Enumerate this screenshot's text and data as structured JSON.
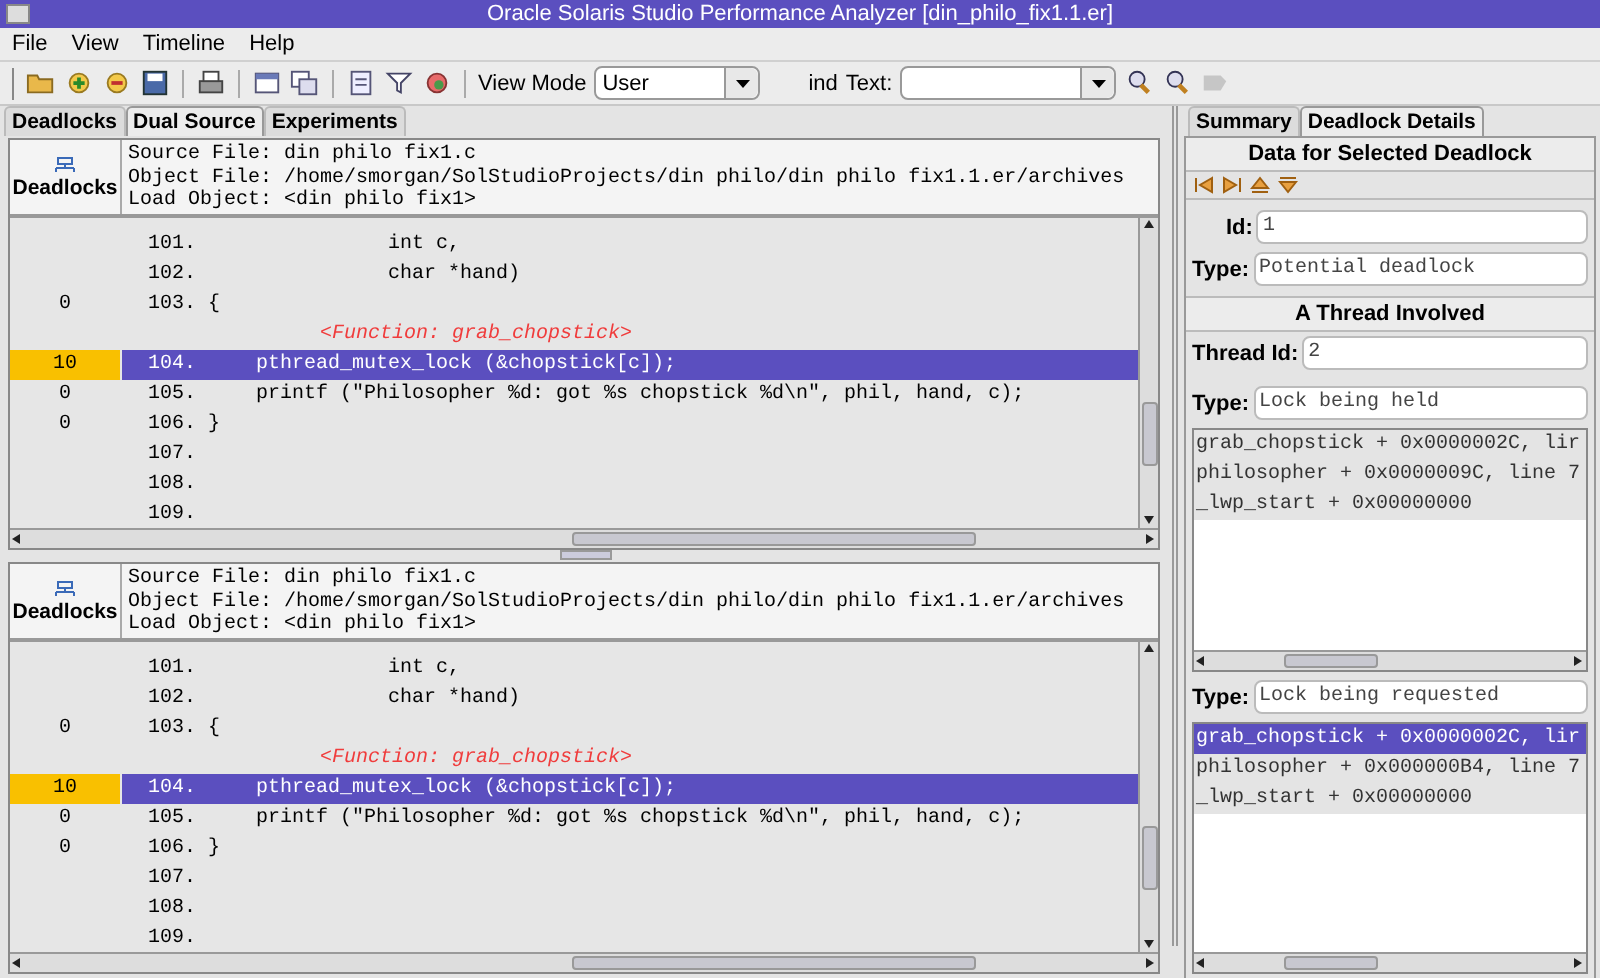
{
  "window": {
    "title": "Oracle Solaris Studio Performance Analyzer [din_philo_fix1.1.er]"
  },
  "menu": [
    "File",
    "View",
    "Timeline",
    "Help"
  ],
  "toolbar": {
    "icons": [
      {
        "kind": "folder"
      },
      {
        "kind": "add"
      },
      {
        "kind": "remove"
      },
      {
        "kind": "save"
      },
      {
        "kind": "sep"
      },
      {
        "kind": "print"
      },
      {
        "kind": "sep"
      },
      {
        "kind": "window"
      },
      {
        "kind": "windows"
      },
      {
        "kind": "sep"
      },
      {
        "kind": "doc"
      },
      {
        "kind": "filter"
      },
      {
        "kind": "target"
      }
    ],
    "view_mode_label": "View Mode",
    "view_mode": "User",
    "find_label": "ind",
    "text_label": "Text:",
    "find_icons": [
      {
        "kind": "find"
      },
      {
        "kind": "find"
      },
      {
        "kind": "clear",
        "disabled": true
      }
    ]
  },
  "tabs": [
    {
      "label": "Deadlocks",
      "selected": false
    },
    {
      "label": "Dual Source",
      "selected": true
    },
    {
      "label": "Experiments",
      "selected": false
    }
  ],
  "panes": [
    {
      "metric_header": "Deadlocks",
      "source_file": "Source File: din philo fix1.c",
      "object_file": "Object File: /home/smorgan/SolStudioProjects/din philo/din philo fix1.1.er/archives",
      "load_object": "Load Object: <din philo fix1>",
      "lines": [
        {
          "kind": "code",
          "number": "101.",
          "code": "               int c,",
          "selected": false
        },
        {
          "kind": "code",
          "number": "102.",
          "code": "               char *hand)",
          "selected": false
        },
        {
          "kind": "code",
          "metric": "0",
          "number": "103.",
          "code": "{",
          "selected": false
        },
        {
          "kind": "function",
          "code": "<Function: grab_chopstick>"
        },
        {
          "kind": "code",
          "metric": "10",
          "number": "104.",
          "code": "    pthread_mutex_lock (&chopstick[c]);",
          "selected": true
        },
        {
          "kind": "code",
          "metric": "0",
          "number": "105.",
          "code": "    printf (\"Philosopher %d: got %s chopstick %d\\n\", phil, hand, c);",
          "selected": false
        },
        {
          "kind": "code",
          "metric": "0",
          "number": "106.",
          "code": "}",
          "selected": false
        },
        {
          "kind": "code",
          "number": "107.",
          "selected": false
        },
        {
          "kind": "code",
          "number": "108.",
          "selected": false
        },
        {
          "kind": "code",
          "number": "109.",
          "selected": false
        }
      ]
    },
    {
      "metric_header": "Deadlocks",
      "source_file": "Source File: din philo fix1.c",
      "object_file": "Object File: /home/smorgan/SolStudioProjects/din philo/din philo fix1.1.er/archives",
      "load_object": "Load Object: <din philo fix1>",
      "lines": [
        {
          "kind": "code",
          "number": "101.",
          "code": "               int c,",
          "selected": false
        },
        {
          "kind": "code",
          "number": "102.",
          "code": "               char *hand)",
          "selected": false
        },
        {
          "kind": "code",
          "metric": "0",
          "number": "103.",
          "code": "{",
          "selected": false
        },
        {
          "kind": "function",
          "code": "<Function: grab_chopstick>"
        },
        {
          "kind": "code",
          "metric": "10",
          "number": "104.",
          "code": "    pthread_mutex_lock (&chopstick[c]);",
          "selected": true
        },
        {
          "kind": "code",
          "metric": "0",
          "number": "105.",
          "code": "    printf (\"Philosopher %d: got %s chopstick %d\\n\", phil, hand, c);",
          "selected": false
        },
        {
          "kind": "code",
          "metric": "0",
          "number": "106.",
          "code": "}",
          "selected": false
        },
        {
          "kind": "code",
          "number": "107.",
          "selected": false
        },
        {
          "kind": "code",
          "number": "108.",
          "selected": false
        },
        {
          "kind": "code",
          "number": "109.",
          "selected": false
        }
      ]
    }
  ],
  "details": {
    "tabs": [
      {
        "label": "Summary",
        "selected": false
      },
      {
        "label": "Deadlock Details",
        "selected": true
      }
    ],
    "header": "Data for Selected Deadlock",
    "id_label": "Id:",
    "id": "1",
    "type_label": "Type:",
    "type": "Potential deadlock",
    "thread_header": "A Thread Involved",
    "thread_id_label": "Thread Id:",
    "thread_id": "2",
    "stacks": [
      {
        "type_label": "Type:",
        "type": "Lock being held",
        "frames": [
          {
            "text": "grab_chopstick + 0x0000002C, lir",
            "selected": false
          },
          {
            "text": "philosopher + 0x0000009C, line 7",
            "selected": false
          },
          {
            "text": "_lwp_start + 0x00000000",
            "selected": false
          }
        ]
      },
      {
        "type_label": "Type:",
        "type": "Lock being requested",
        "frames": [
          {
            "text": "grab_chopstick + 0x0000002C, lir",
            "selected": true
          },
          {
            "text": "philosopher + 0x000000B4, line 7",
            "selected": false
          },
          {
            "text": "_lwp_start + 0x00000000",
            "selected": false
          }
        ]
      }
    ]
  }
}
